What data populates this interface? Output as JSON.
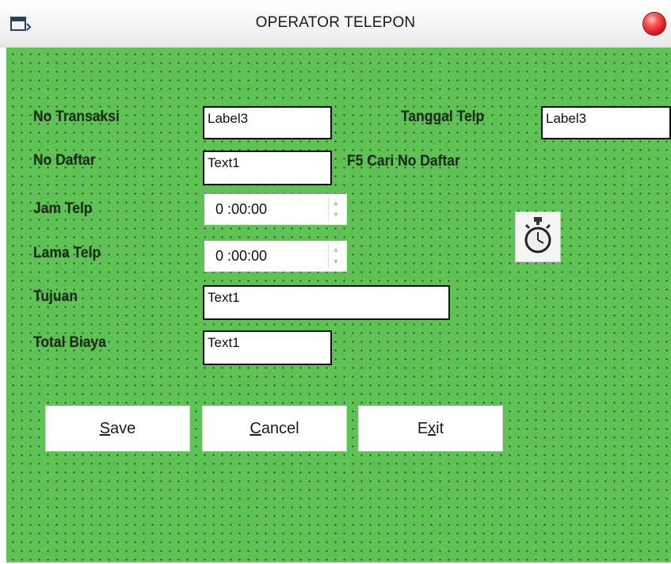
{
  "window": {
    "title": "OPERATOR TELEPON",
    "icon": "form-icon",
    "close_icon": "close-icon"
  },
  "form": {
    "labels": {
      "no_transaksi": "No Transaksi",
      "tanggal_telp": "Tanggal Telp",
      "no_daftar": "No Daftar",
      "f5_hint": "F5 Cari No Daftar",
      "jam_telp": "Jam Telp",
      "lama_telp": "Lama Telp",
      "tujuan": "Tujuan",
      "total_biaya": "Total Biaya"
    },
    "values": {
      "no_transaksi": "Label3",
      "tanggal_telp": "Label3",
      "no_daftar": "Text1",
      "jam_telp": "0 :00:00",
      "lama_telp": "0 :00:00",
      "tujuan": "Text1",
      "total_biaya": "Text1"
    },
    "timer_icon": "stopwatch-icon"
  },
  "buttons": {
    "save": {
      "first": "S",
      "rest": "ave"
    },
    "cancel": {
      "first": "C",
      "rest": "ancel"
    },
    "exit": {
      "pre": "E",
      "mid": "x",
      "post": "it"
    }
  },
  "colors": {
    "form_background": "#5fc254"
  }
}
